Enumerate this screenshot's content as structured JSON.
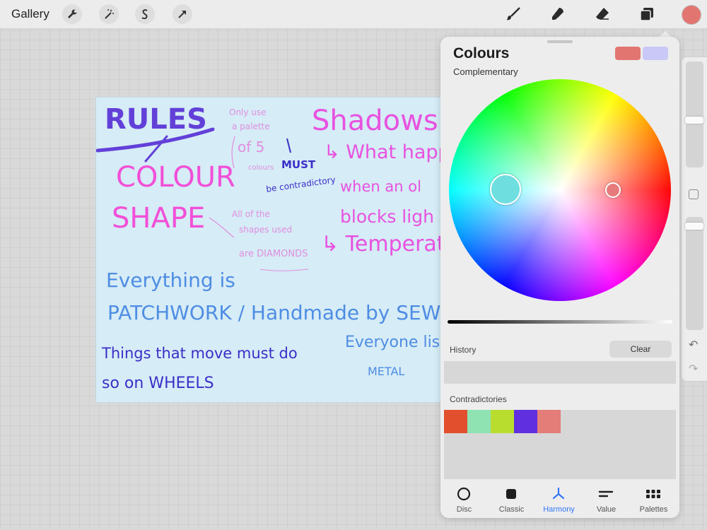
{
  "topbar": {
    "gallery_label": "Gallery",
    "left_tools": [
      "wrench-icon",
      "magic-wand-icon",
      "selection-icon",
      "transform-arrow-icon"
    ],
    "right_tools": [
      "brush-icon",
      "smudge-icon",
      "eraser-icon",
      "layers-icon"
    ],
    "current_color": "#e37571"
  },
  "canvas": {
    "lines": [
      "RULES",
      "Only use",
      "a palette",
      "of 5",
      "colours",
      "MUST",
      "be contradictory",
      "Shadows",
      "↳ What happ",
      "when an ol",
      "blocks ligh",
      "↳ Temperatu",
      "COLOUR",
      "SHAPE",
      "All of the",
      "shapes used",
      "are DIAMONDS",
      "Everything is",
      "PATCHWORK / Handmade by SEWING",
      "Everyone lis",
      "METAL",
      "Things that move must do",
      "so on WHEELS"
    ]
  },
  "colour_panel": {
    "title": "Colours",
    "mode": "Complementary",
    "primary_swatch": "#e37571",
    "secondary_swatch": "#c9c8f7",
    "harmony_primary": "#6fdedf",
    "harmony_secondary": "#e77b7b",
    "history_label": "History",
    "clear_label": "Clear",
    "palette_name": "Contradictories",
    "palette": [
      "#e24f2d",
      "#8fe3b2",
      "#b9dd2f",
      "#5f2fe0",
      "#e47c78"
    ]
  },
  "tabs": [
    {
      "label": "Disc",
      "icon": "disc-icon"
    },
    {
      "label": "Classic",
      "icon": "classic-icon"
    },
    {
      "label": "Harmony",
      "icon": "harmony-icon"
    },
    {
      "label": "Value",
      "icon": "value-icon"
    },
    {
      "label": "Palettes",
      "icon": "palettes-icon"
    }
  ],
  "active_tab": "Harmony"
}
